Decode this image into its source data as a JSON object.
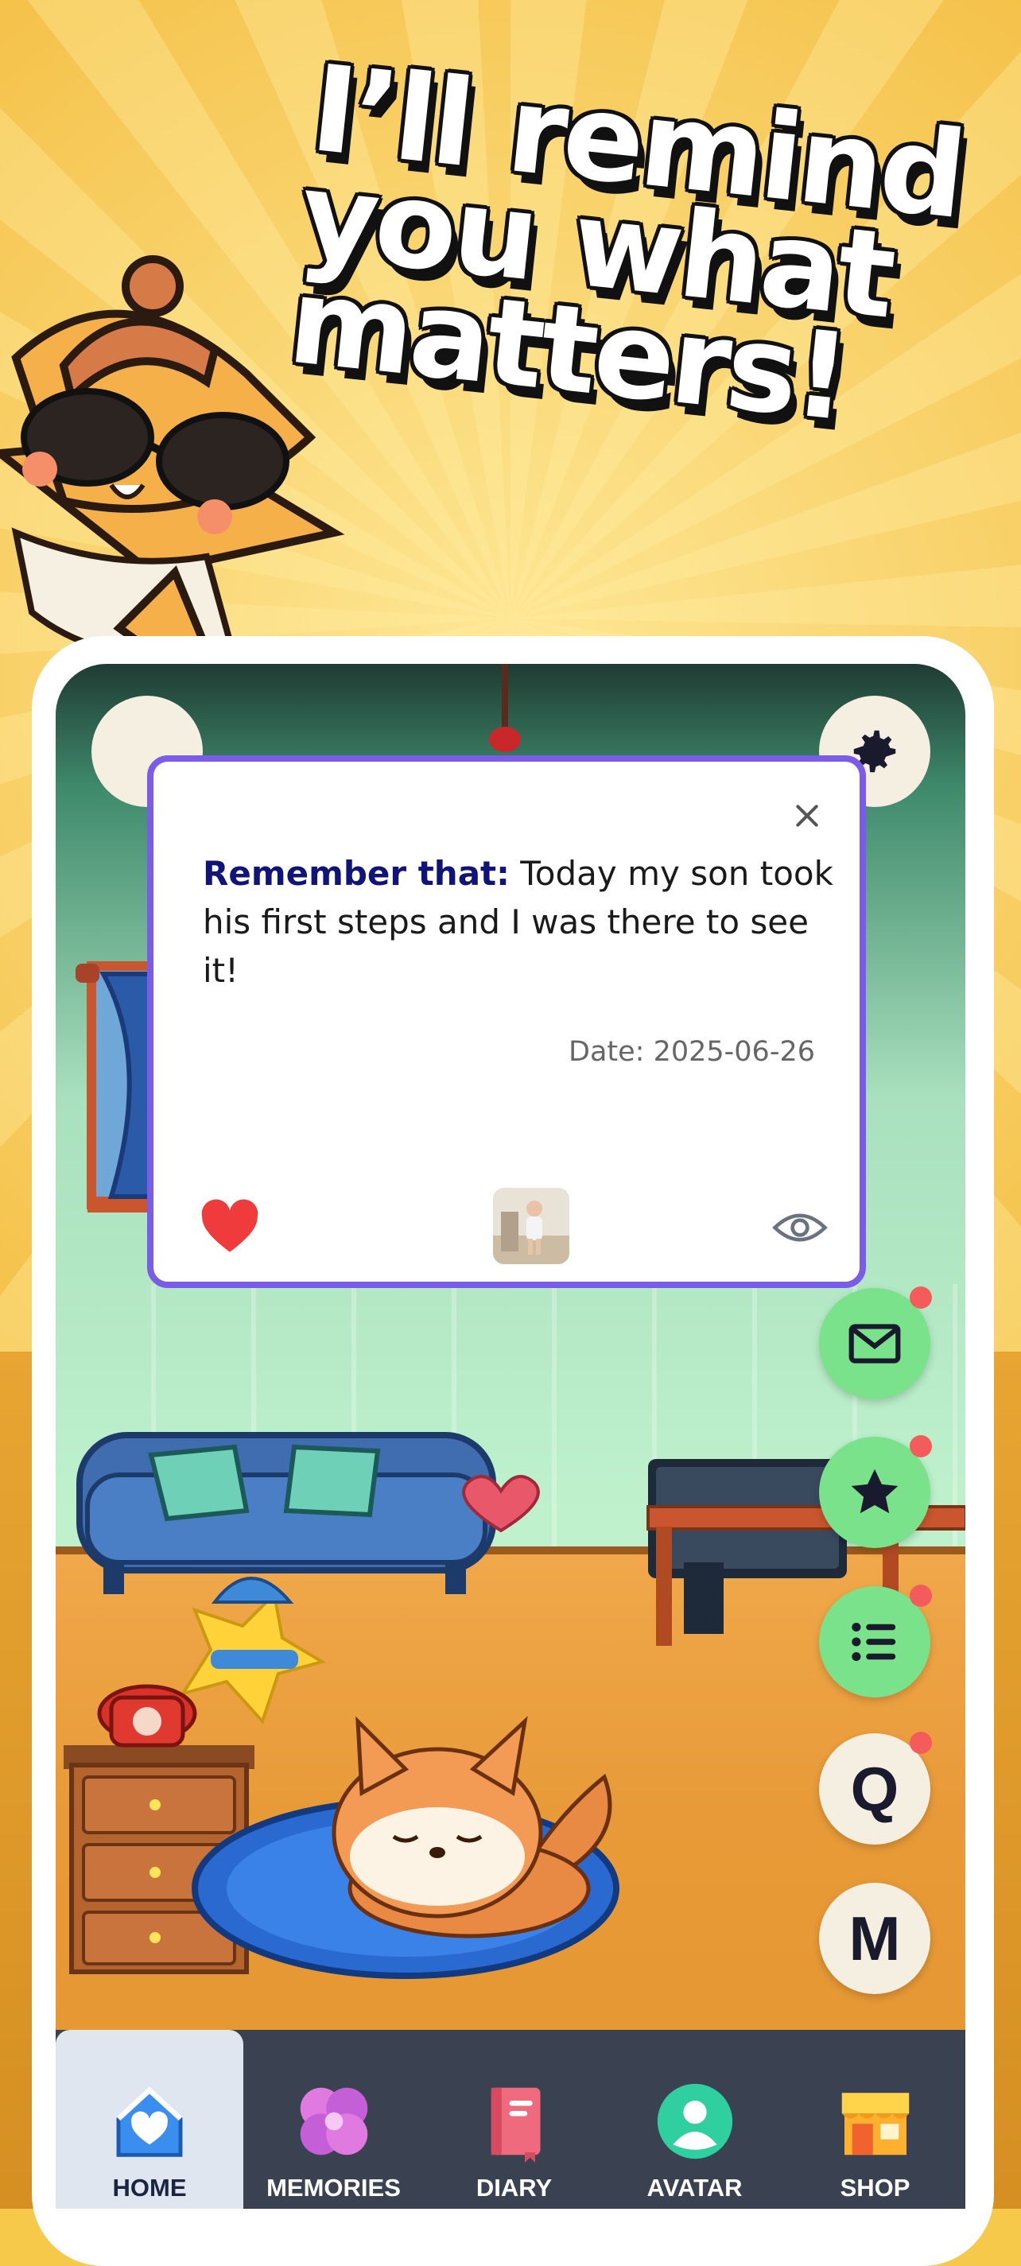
{
  "headline": "I’ll remind\nyou what\nmatters!",
  "popup": {
    "lead": "Remember that:",
    "text": " Today my son took his first steps and I was there to see it!",
    "date": "Date: 2025-06-26"
  },
  "side_buttons": {
    "q_label": "Q",
    "m_label": "M"
  },
  "tabs": [
    {
      "label": "HOME",
      "icon": "home-icon"
    },
    {
      "label": "MEMORIES",
      "icon": "puzzle-icon"
    },
    {
      "label": "DIARY",
      "icon": "diary-icon"
    },
    {
      "label": "AVATAR",
      "icon": "avatar-icon"
    },
    {
      "label": "SHOP",
      "icon": "shop-icon"
    }
  ],
  "colors": {
    "accent": "#7b5ce8",
    "notification": "#f45b5b",
    "green_button": "#79e28a",
    "tabbar": "#3a4252"
  }
}
